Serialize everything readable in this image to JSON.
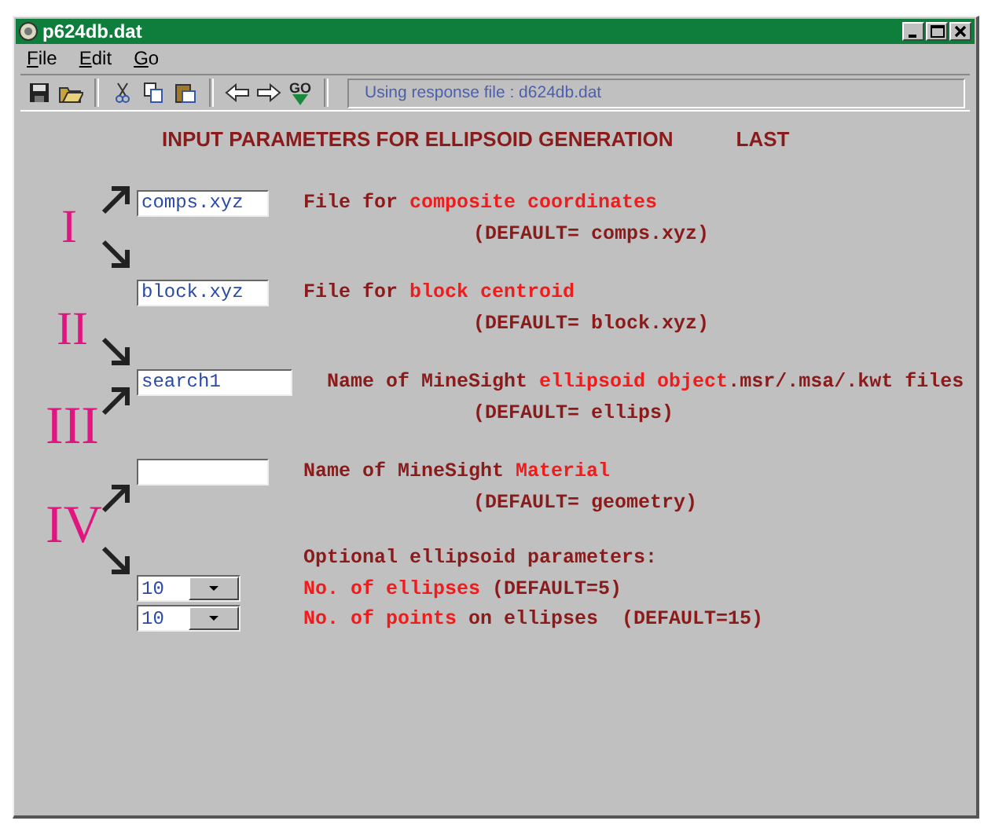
{
  "window": {
    "title": "p624db.dat"
  },
  "menu": [
    {
      "mnemonic": "F",
      "rest": "ile"
    },
    {
      "mnemonic": "E",
      "rest": "dit"
    },
    {
      "mnemonic": "G",
      "rest": "o"
    }
  ],
  "toolbar": {
    "go_label": "GO",
    "status": "Using response file : d624db.dat"
  },
  "heading": {
    "title": "INPUT PARAMETERS FOR ELLIPSOID GENERATION",
    "tag": "LAST"
  },
  "annotations": [
    {
      "label": "I"
    },
    {
      "label": "II"
    },
    {
      "label": "III"
    },
    {
      "label": "IV"
    }
  ],
  "fields": [
    {
      "kind": "text",
      "value": "comps.xyz",
      "wide": false,
      "description": [
        {
          "text": "File for ",
          "highlight": false
        },
        {
          "text": "composite coordinates",
          "highlight": true
        }
      ],
      "default": "(DEFAULT= comps.xyz)"
    },
    {
      "kind": "text",
      "value": "block.xyz",
      "wide": false,
      "description": [
        {
          "text": "File for ",
          "highlight": false
        },
        {
          "text": "block centroid",
          "highlight": true
        }
      ],
      "default": "(DEFAULT= block.xyz)"
    },
    {
      "kind": "text",
      "value": "search1",
      "wide": true,
      "description": [
        {
          "text": "Name of MineSight ",
          "highlight": false
        },
        {
          "text": "ellipsoid object",
          "highlight": true
        },
        {
          "text": ".msr/.msa/.kwt files",
          "highlight": false
        }
      ],
      "default": "(DEFAULT= ellips)"
    },
    {
      "kind": "text",
      "wide": false,
      "description": [
        {
          "text": "Name of MineSight ",
          "highlight": false
        },
        {
          "text": "Material",
          "highlight": true
        }
      ],
      "default": "(DEFAULT= geometry)"
    }
  ],
  "optional": {
    "title": "Optional ellipsoid parameters:",
    "combos": [
      {
        "value": "10",
        "description": [
          {
            "text": "No. of ellipses",
            "highlight": true
          },
          {
            "text": " (DEFAULT=5)",
            "highlight": false
          }
        ]
      },
      {
        "value": "10",
        "description": [
          {
            "text": "No. of points",
            "highlight": true
          },
          {
            "text": " on ellipses  (DEFAULT=15)",
            "highlight": false
          }
        ]
      }
    ]
  }
}
